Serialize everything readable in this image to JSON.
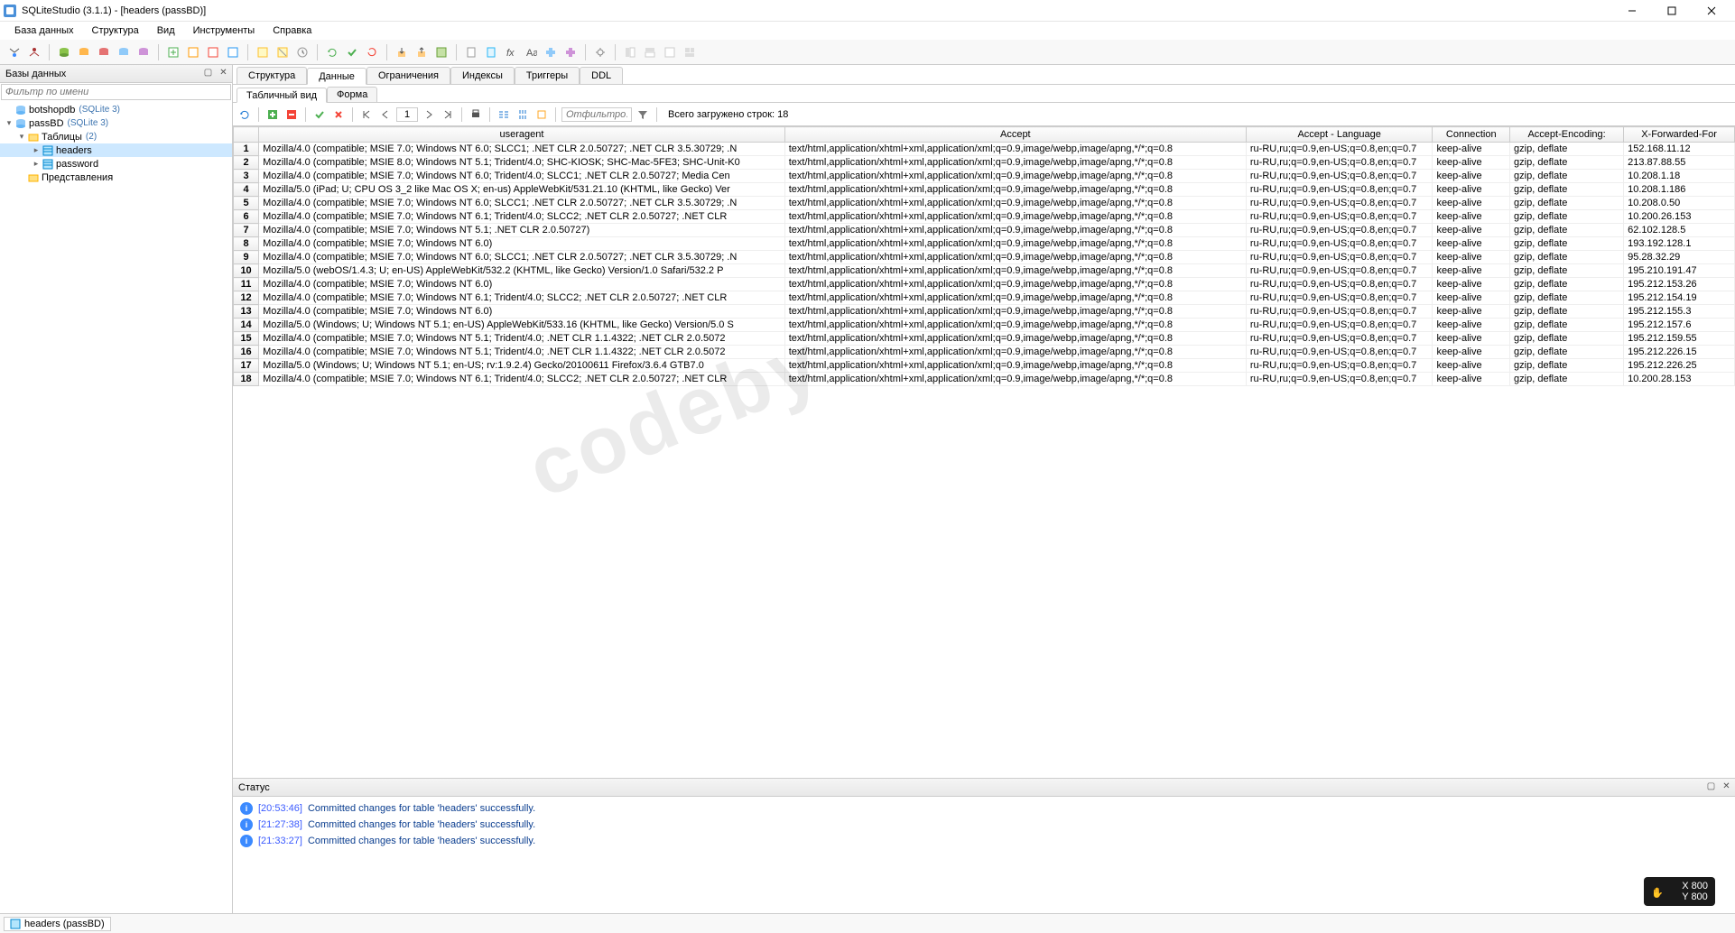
{
  "window": {
    "title": "SQLiteStudio (3.1.1) - [headers (passBD)]"
  },
  "menu": [
    "База данных",
    "Структура",
    "Вид",
    "Инструменты",
    "Справка"
  ],
  "sidebar": {
    "title": "Базы данных",
    "filter_placeholder": "Фильтр по имени",
    "items": [
      {
        "label": "botshopdb",
        "meta": "(SQLite 3)",
        "depth": 0,
        "twisty": "",
        "icon": "db"
      },
      {
        "label": "passBD",
        "meta": "(SQLite 3)",
        "depth": 0,
        "twisty": "▾",
        "icon": "db"
      },
      {
        "label": "Таблицы",
        "meta": "(2)",
        "depth": 1,
        "twisty": "▾",
        "icon": "folder"
      },
      {
        "label": "headers",
        "meta": "",
        "depth": 2,
        "twisty": "▸",
        "icon": "table",
        "sel": true
      },
      {
        "label": "password",
        "meta": "",
        "depth": 2,
        "twisty": "▸",
        "icon": "table"
      },
      {
        "label": "Представления",
        "meta": "",
        "depth": 1,
        "twisty": "",
        "icon": "folder"
      }
    ]
  },
  "tabs": {
    "main": [
      "Структура",
      "Данные",
      "Ограничения",
      "Индексы",
      "Триггеры",
      "DDL"
    ],
    "main_active": 1,
    "sub": [
      "Табличный вид",
      "Форма"
    ],
    "sub_active": 0
  },
  "data_toolbar": {
    "page": "1",
    "filter_placeholder": "Отфильтро…",
    "status": "Всего загружено строк: 18"
  },
  "grid": {
    "columns": [
      "useragent",
      "Accept",
      "Accept - Language",
      "Connection",
      "Accept-Encoding:",
      "X-Forwarded-For"
    ],
    "rows": [
      [
        "Mozilla/4.0 (compatible; MSIE 7.0; Windows NT 6.0; SLCC1; .NET CLR 2.0.50727; .NET CLR 3.5.30729; .N",
        "text/html,application/xhtml+xml,application/xml;q=0.9,image/webp,image/apng,*/*;q=0.8",
        "ru-RU,ru;q=0.9,en-US;q=0.8,en;q=0.7",
        "keep-alive",
        "gzip, deflate",
        "152.168.11.12"
      ],
      [
        "Mozilla/4.0 (compatible; MSIE 8.0; Windows NT 5.1; Trident/4.0; SHC-KIOSK; SHC-Mac-5FE3; SHC-Unit-K0",
        "text/html,application/xhtml+xml,application/xml;q=0.9,image/webp,image/apng,*/*;q=0.8",
        "ru-RU,ru;q=0.9,en-US;q=0.8,en;q=0.7",
        "keep-alive",
        "gzip, deflate",
        "213.87.88.55"
      ],
      [
        "Mozilla/4.0 (compatible; MSIE 7.0; Windows NT 6.0; Trident/4.0; SLCC1; .NET CLR 2.0.50727; Media Cen",
        "text/html,application/xhtml+xml,application/xml;q=0.9,image/webp,image/apng,*/*;q=0.8",
        "ru-RU,ru;q=0.9,en-US;q=0.8,en;q=0.7",
        "keep-alive",
        "gzip, deflate",
        "10.208.1.18"
      ],
      [
        "Mozilla/5.0 (iPad; U; CPU OS 3_2 like Mac OS X; en-us) AppleWebKit/531.21.10 (KHTML, like Gecko) Ver",
        "text/html,application/xhtml+xml,application/xml;q=0.9,image/webp,image/apng,*/*;q=0.8",
        "ru-RU,ru;q=0.9,en-US;q=0.8,en;q=0.7",
        "keep-alive",
        "gzip, deflate",
        "10.208.1.186"
      ],
      [
        "Mozilla/4.0 (compatible; MSIE 7.0; Windows NT 6.0; SLCC1; .NET CLR 2.0.50727; .NET CLR 3.5.30729; .N",
        "text/html,application/xhtml+xml,application/xml;q=0.9,image/webp,image/apng,*/*;q=0.8",
        "ru-RU,ru;q=0.9,en-US;q=0.8,en;q=0.7",
        "keep-alive",
        "gzip, deflate",
        "10.208.0.50"
      ],
      [
        "Mozilla/4.0 (compatible; MSIE 7.0; Windows NT 6.1; Trident/4.0; SLCC2; .NET CLR 2.0.50727; .NET CLR",
        "text/html,application/xhtml+xml,application/xml;q=0.9,image/webp,image/apng,*/*;q=0.8",
        "ru-RU,ru;q=0.9,en-US;q=0.8,en;q=0.7",
        "keep-alive",
        "gzip, deflate",
        "10.200.26.153"
      ],
      [
        "Mozilla/4.0 (compatible; MSIE 7.0; Windows NT 5.1; .NET CLR 2.0.50727)",
        "text/html,application/xhtml+xml,application/xml;q=0.9,image/webp,image/apng,*/*;q=0.8",
        "ru-RU,ru;q=0.9,en-US;q=0.8,en;q=0.7",
        "keep-alive",
        "gzip, deflate",
        "62.102.128.5"
      ],
      [
        "Mozilla/4.0 (compatible; MSIE 7.0; Windows NT 6.0)",
        "text/html,application/xhtml+xml,application/xml;q=0.9,image/webp,image/apng,*/*;q=0.8",
        "ru-RU,ru;q=0.9,en-US;q=0.8,en;q=0.7",
        "keep-alive",
        "gzip, deflate",
        "193.192.128.1"
      ],
      [
        "Mozilla/4.0 (compatible; MSIE 7.0; Windows NT 6.0; SLCC1; .NET CLR 2.0.50727; .NET CLR 3.5.30729; .N",
        "text/html,application/xhtml+xml,application/xml;q=0.9,image/webp,image/apng,*/*;q=0.8",
        "ru-RU,ru;q=0.9,en-US;q=0.8,en;q=0.7",
        "keep-alive",
        "gzip, deflate",
        "95.28.32.29"
      ],
      [
        "Mozilla/5.0 (webOS/1.4.3; U; en-US) AppleWebKit/532.2 (KHTML, like Gecko) Version/1.0 Safari/532.2 P",
        "text/html,application/xhtml+xml,application/xml;q=0.9,image/webp,image/apng,*/*;q=0.8",
        "ru-RU,ru;q=0.9,en-US;q=0.8,en;q=0.7",
        "keep-alive",
        "gzip, deflate",
        "195.210.191.47"
      ],
      [
        "Mozilla/4.0 (compatible; MSIE 7.0; Windows NT 6.0)",
        "text/html,application/xhtml+xml,application/xml;q=0.9,image/webp,image/apng,*/*;q=0.8",
        "ru-RU,ru;q=0.9,en-US;q=0.8,en;q=0.7",
        "keep-alive",
        "gzip, deflate",
        "195.212.153.26"
      ],
      [
        "Mozilla/4.0 (compatible; MSIE 7.0; Windows NT 6.1; Trident/4.0; SLCC2; .NET CLR 2.0.50727; .NET CLR",
        "text/html,application/xhtml+xml,application/xml;q=0.9,image/webp,image/apng,*/*;q=0.8",
        "ru-RU,ru;q=0.9,en-US;q=0.8,en;q=0.7",
        "keep-alive",
        "gzip, deflate",
        "195.212.154.19"
      ],
      [
        "Mozilla/4.0 (compatible; MSIE 7.0; Windows NT 6.0)",
        "text/html,application/xhtml+xml,application/xml;q=0.9,image/webp,image/apng,*/*;q=0.8",
        "ru-RU,ru;q=0.9,en-US;q=0.8,en;q=0.7",
        "keep-alive",
        "gzip, deflate",
        "195.212.155.3"
      ],
      [
        "Mozilla/5.0 (Windows; U; Windows NT 5.1; en-US) AppleWebKit/533.16 (KHTML, like Gecko) Version/5.0 S",
        "text/html,application/xhtml+xml,application/xml;q=0.9,image/webp,image/apng,*/*;q=0.8",
        "ru-RU,ru;q=0.9,en-US;q=0.8,en;q=0.7",
        "keep-alive",
        "gzip, deflate",
        "195.212.157.6"
      ],
      [
        "Mozilla/4.0 (compatible; MSIE 7.0; Windows NT 5.1; Trident/4.0; .NET CLR 1.1.4322; .NET CLR 2.0.5072",
        "text/html,application/xhtml+xml,application/xml;q=0.9,image/webp,image/apng,*/*;q=0.8",
        "ru-RU,ru;q=0.9,en-US;q=0.8,en;q=0.7",
        "keep-alive",
        "gzip, deflate",
        "195.212.159.55"
      ],
      [
        "Mozilla/4.0 (compatible; MSIE 7.0; Windows NT 5.1; Trident/4.0; .NET CLR 1.1.4322; .NET CLR 2.0.5072",
        "text/html,application/xhtml+xml,application/xml;q=0.9,image/webp,image/apng,*/*;q=0.8",
        "ru-RU,ru;q=0.9,en-US;q=0.8,en;q=0.7",
        "keep-alive",
        "gzip, deflate",
        "195.212.226.15"
      ],
      [
        "Mozilla/5.0 (Windows; U; Windows NT 5.1; en-US; rv:1.9.2.4) Gecko/20100611 Firefox/3.6.4 GTB7.0",
        "text/html,application/xhtml+xml,application/xml;q=0.9,image/webp,image/apng,*/*;q=0.8",
        "ru-RU,ru;q=0.9,en-US;q=0.8,en;q=0.7",
        "keep-alive",
        "gzip, deflate",
        "195.212.226.25"
      ],
      [
        "Mozilla/4.0 (compatible; MSIE 7.0; Windows NT 6.1; Trident/4.0; SLCC2; .NET CLR 2.0.50727; .NET CLR",
        "text/html,application/xhtml+xml,application/xml;q=0.9,image/webp,image/apng,*/*;q=0.8",
        "ru-RU,ru;q=0.9,en-US;q=0.8,en;q=0.7",
        "keep-alive",
        "gzip, deflate",
        "10.200.28.153"
      ]
    ]
  },
  "status_panel": {
    "title": "Статус",
    "lines": [
      {
        "ts": "[20:53:46]",
        "msg": "Committed changes for table 'headers' successfully."
      },
      {
        "ts": "[21:27:38]",
        "msg": "Committed changes for table 'headers' successfully."
      },
      {
        "ts": "[21:33:27]",
        "msg": "Committed changes for table 'headers' successfully."
      }
    ]
  },
  "footbar": {
    "tab": "headers (passBD)"
  },
  "tray": {
    "x": "X 800",
    "y": "Y 800"
  },
  "watermark": "codeby"
}
